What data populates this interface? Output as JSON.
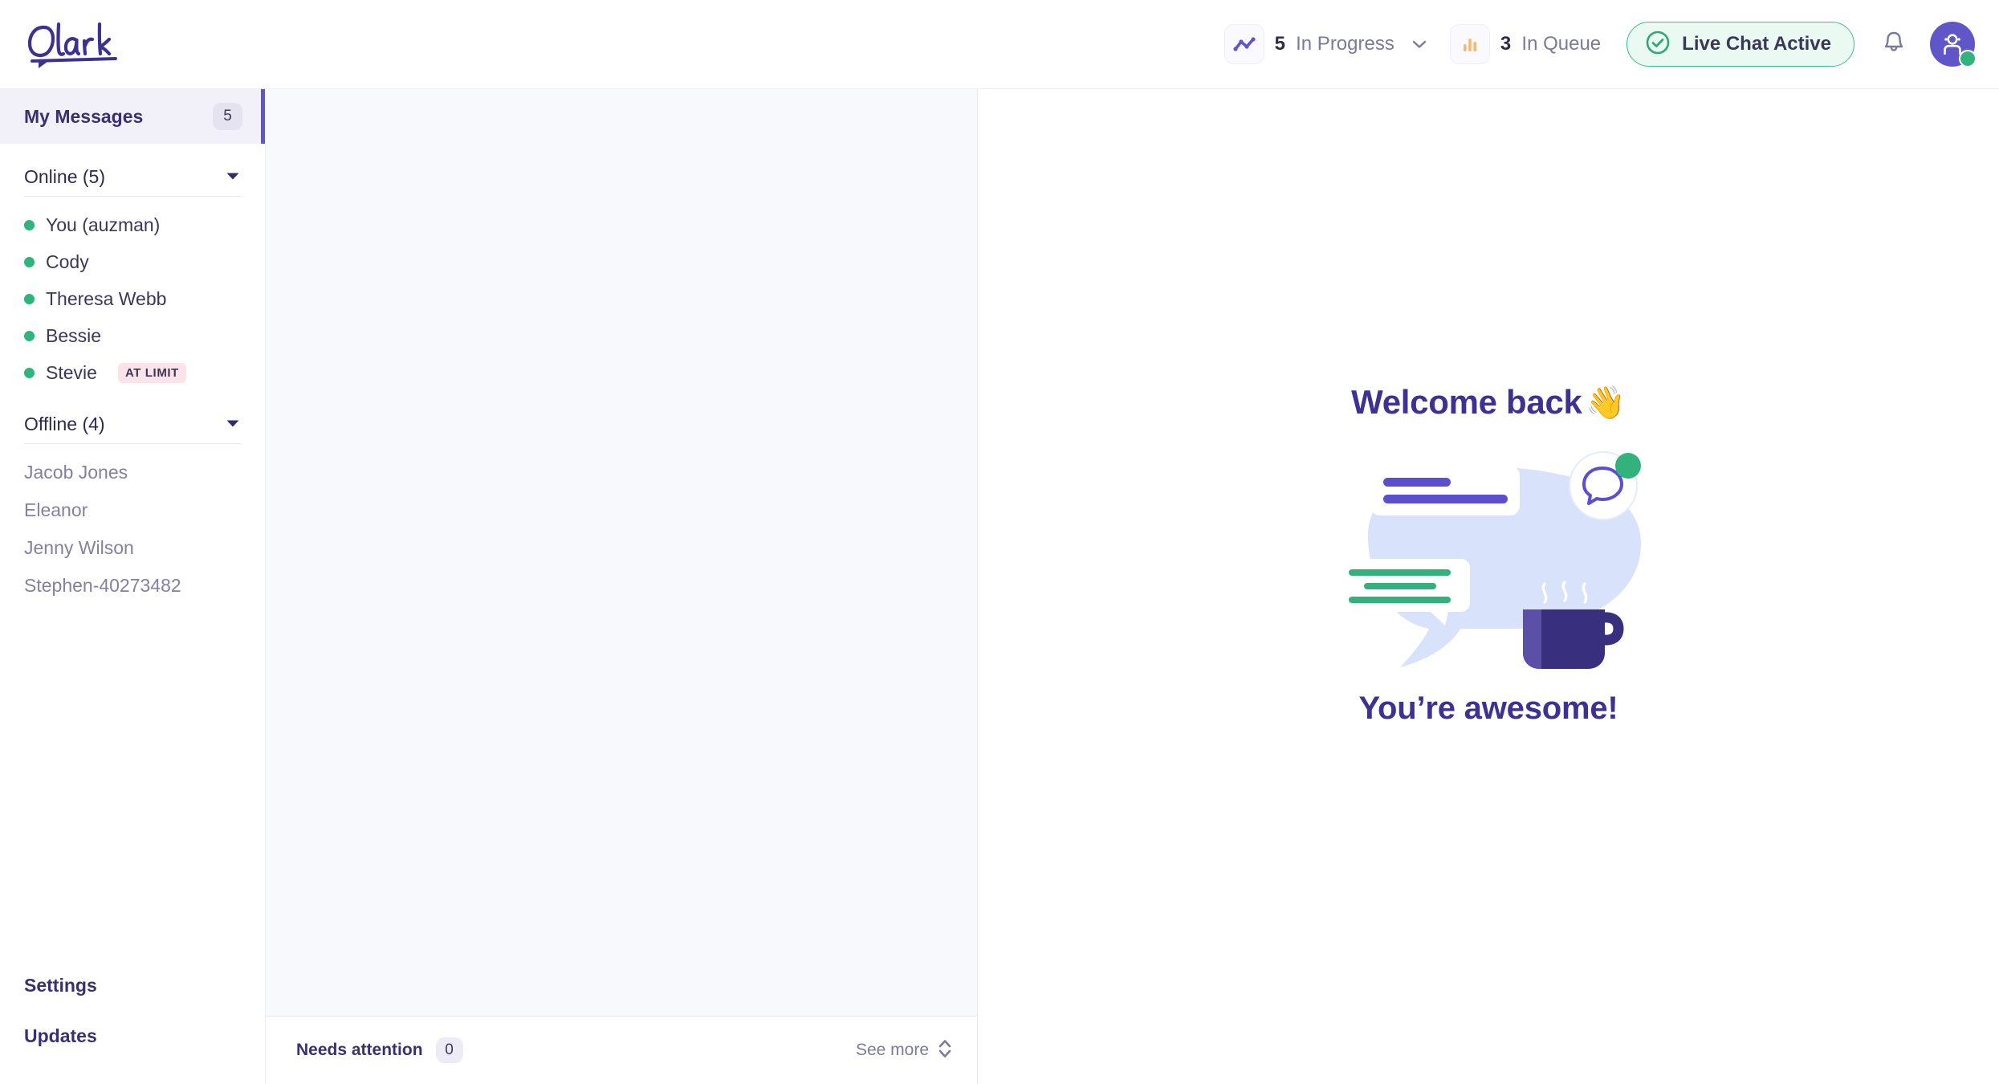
{
  "brand": {
    "logo_text": "Olark",
    "purple": "#3D3291",
    "accent": "#6156C8",
    "green": "#33B27E",
    "orange": "#F9B96A",
    "pink_badge": "#FCE3E9"
  },
  "topbar": {
    "stats": [
      {
        "icon": "trend-line-icon",
        "count": "5",
        "label": "In Progress",
        "has_dropdown": true
      },
      {
        "icon": "bar-chart-icon",
        "count": "3",
        "label": "In Queue",
        "has_dropdown": false
      }
    ],
    "status_pill": {
      "icon": "check-circle-icon",
      "label": "Live Chat Active"
    },
    "notifications_icon": "bell-icon",
    "avatar": {
      "icon": "agent-avatar-icon",
      "status": "online"
    }
  },
  "sidebar": {
    "my_messages": {
      "label": "My Messages",
      "badge": "5"
    },
    "groups": [
      {
        "title": "Online (5)",
        "expanded": true,
        "people": [
          {
            "name": "You (auzman)",
            "online": true,
            "badge": ""
          },
          {
            "name": "Cody",
            "online": true,
            "badge": ""
          },
          {
            "name": "Theresa Webb",
            "online": true,
            "badge": ""
          },
          {
            "name": "Bessie",
            "online": true,
            "badge": ""
          },
          {
            "name": "Stevie",
            "online": true,
            "badge": "AT LIMIT"
          }
        ]
      },
      {
        "title": "Offline (4)",
        "expanded": true,
        "people": [
          {
            "name": "Jacob Jones",
            "online": false,
            "badge": ""
          },
          {
            "name": "Eleanor",
            "online": false,
            "badge": ""
          },
          {
            "name": "Jenny Wilson",
            "online": false,
            "badge": ""
          },
          {
            "name": "Stephen-40273482",
            "online": false,
            "badge": ""
          }
        ]
      }
    ],
    "bottom_links": [
      {
        "label": "Settings"
      },
      {
        "label": "Updates"
      }
    ]
  },
  "mid_panel": {
    "needs_attention": {
      "label": "Needs attention",
      "badge": "0"
    },
    "see_more": {
      "label": "See more",
      "icon": "chevron-up-down-icon"
    }
  },
  "main": {
    "welcome_title": "Welcome back",
    "welcome_emoji": "👋",
    "welcome_sub": "You’re awesome!",
    "illustration": "chat-bubbles-coffee-mug-illustration"
  }
}
